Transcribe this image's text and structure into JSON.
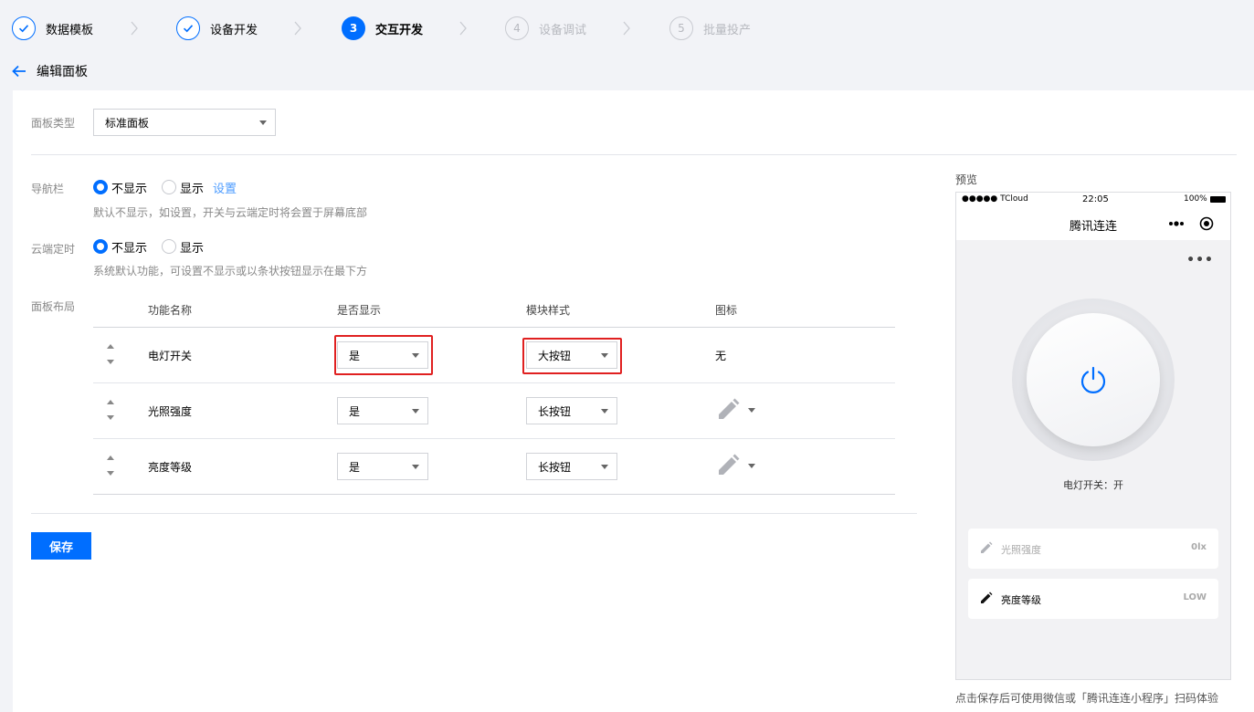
{
  "steps": [
    {
      "num": "1",
      "label": "数据模板",
      "state": "done"
    },
    {
      "num": "2",
      "label": "设备开发",
      "state": "done"
    },
    {
      "num": "3",
      "label": "交互开发",
      "state": "active"
    },
    {
      "num": "4",
      "label": "设备调试",
      "state": "todo"
    },
    {
      "num": "5",
      "label": "批量投产",
      "state": "todo"
    }
  ],
  "header": {
    "title": "编辑面板"
  },
  "form": {
    "panel_type_label": "面板类型",
    "panel_type_value": "标准面板",
    "nav_label": "导航栏",
    "nav_opt_hide": "不显示",
    "nav_opt_show": "显示",
    "nav_settings_link": "设置",
    "nav_hint": "默认不显示，如设置，开关与云端定时将会置于屏幕底部",
    "timer_label": "云端定时",
    "timer_opt_hide": "不显示",
    "timer_opt_show": "显示",
    "timer_hint": "系统默认功能，可设置不显示或以条状按钮显示在最下方",
    "layout_label": "面板布局"
  },
  "table": {
    "headers": {
      "name": "功能名称",
      "show": "是否显示",
      "style": "模块样式",
      "icon": "图标"
    },
    "rows": [
      {
        "name": "电灯开关",
        "show": "是",
        "style": "大按钮",
        "icon": "无"
      },
      {
        "name": "光照强度",
        "show": "是",
        "style": "长按钮",
        "icon": "pencil-icon"
      },
      {
        "name": "亮度等级",
        "show": "是",
        "style": "长按钮",
        "icon": "pencil-icon"
      }
    ]
  },
  "save_label": "保存",
  "preview": {
    "title": "预览",
    "status_carrier": "●●●●● TCloud",
    "status_time": "22:05",
    "status_battery": "100%",
    "nav_title": "腾讯连连",
    "more": "•••",
    "power_label": "电灯开关：开",
    "cards": [
      {
        "label": "光照强度",
        "value": "0lx",
        "enabled": false
      },
      {
        "label": "亮度等级",
        "value": "LOW",
        "enabled": true
      }
    ],
    "footer": "点击保存后可使用微信或「腾讯连连小程序」扫码体验"
  },
  "colors": {
    "accent": "#006eff",
    "highlight": "#e02020"
  }
}
